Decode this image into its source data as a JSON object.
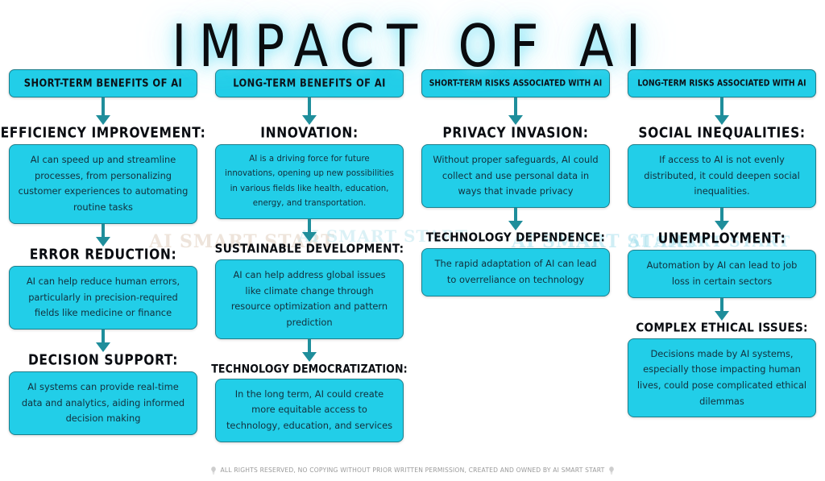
{
  "title": "IMPACT OF AI",
  "theme": {
    "box_fill": "#22cee8",
    "box_border": "#1d7f8c",
    "arrow_color": "#1f8e9b",
    "title_color": "#0a0c0f",
    "title_glow": "#78e1f5",
    "body_text_color": "#12303d",
    "background": "#ffffff"
  },
  "watermark_text": "AI SMART START",
  "columns": [
    {
      "header": "SHORT-TERM BENEFITS OF AI",
      "items": [
        {
          "title": "EFFICIENCY IMPROVEMENT:",
          "body": "AI can speed up and streamline processes, from personalizing customer experiences to automating routine tasks"
        },
        {
          "title": "ERROR REDUCTION:",
          "body": "AI can help reduce human errors, particularly in precision-required fields like medicine or finance"
        },
        {
          "title": "DECISION SUPPORT:",
          "body": "AI systems can provide real-time data and analytics, aiding informed decision making"
        }
      ]
    },
    {
      "header": "LONG-TERM BENEFITS OF AI",
      "items": [
        {
          "title": "INNOVATION:",
          "body": "AI is a driving force for future innovations, opening up new possibilities in various fields like health, education, energy, and transportation."
        },
        {
          "title": "SUSTAINABLE DEVELOPMENT:",
          "body": "AI can help address global issues like climate change through resource optimization and pattern prediction"
        },
        {
          "title": "TECHNOLOGY DEMOCRATIZATION:",
          "body": "In the long term, AI could create more equitable access to technology, education, and services"
        }
      ]
    },
    {
      "header": "SHORT-TERM RISKS ASSOCIATED WITH AI",
      "items": [
        {
          "title": "PRIVACY INVASION:",
          "body": "Without proper safeguards, AI could collect and use personal data in ways that invade privacy"
        },
        {
          "title": "TECHNOLOGY DEPENDENCE:",
          "body": "The rapid adaptation of AI can lead to overreliance on technology"
        }
      ]
    },
    {
      "header": "LONG-TERM RISKS ASSOCIATED WITH AI",
      "items": [
        {
          "title": "SOCIAL INEQUALITIES:",
          "body": "If access to AI is not evenly distributed, it could deepen social inequalities."
        },
        {
          "title": "UNEMPLOYMENT:",
          "body": "Automation by AI can lead to job loss in certain sectors"
        },
        {
          "title": "COMPLEX ETHICAL ISSUES:",
          "body": "Decisions made by AI systems, especially those impacting human lives, could pose complicated ethical dilemmas"
        }
      ]
    }
  ],
  "footer": {
    "text": "ALL RIGHTS RESERVED, NO COPYING WITHOUT PRIOR WRITTEN PERMISSION, CREATED AND OWNED BY AI SMART START"
  }
}
